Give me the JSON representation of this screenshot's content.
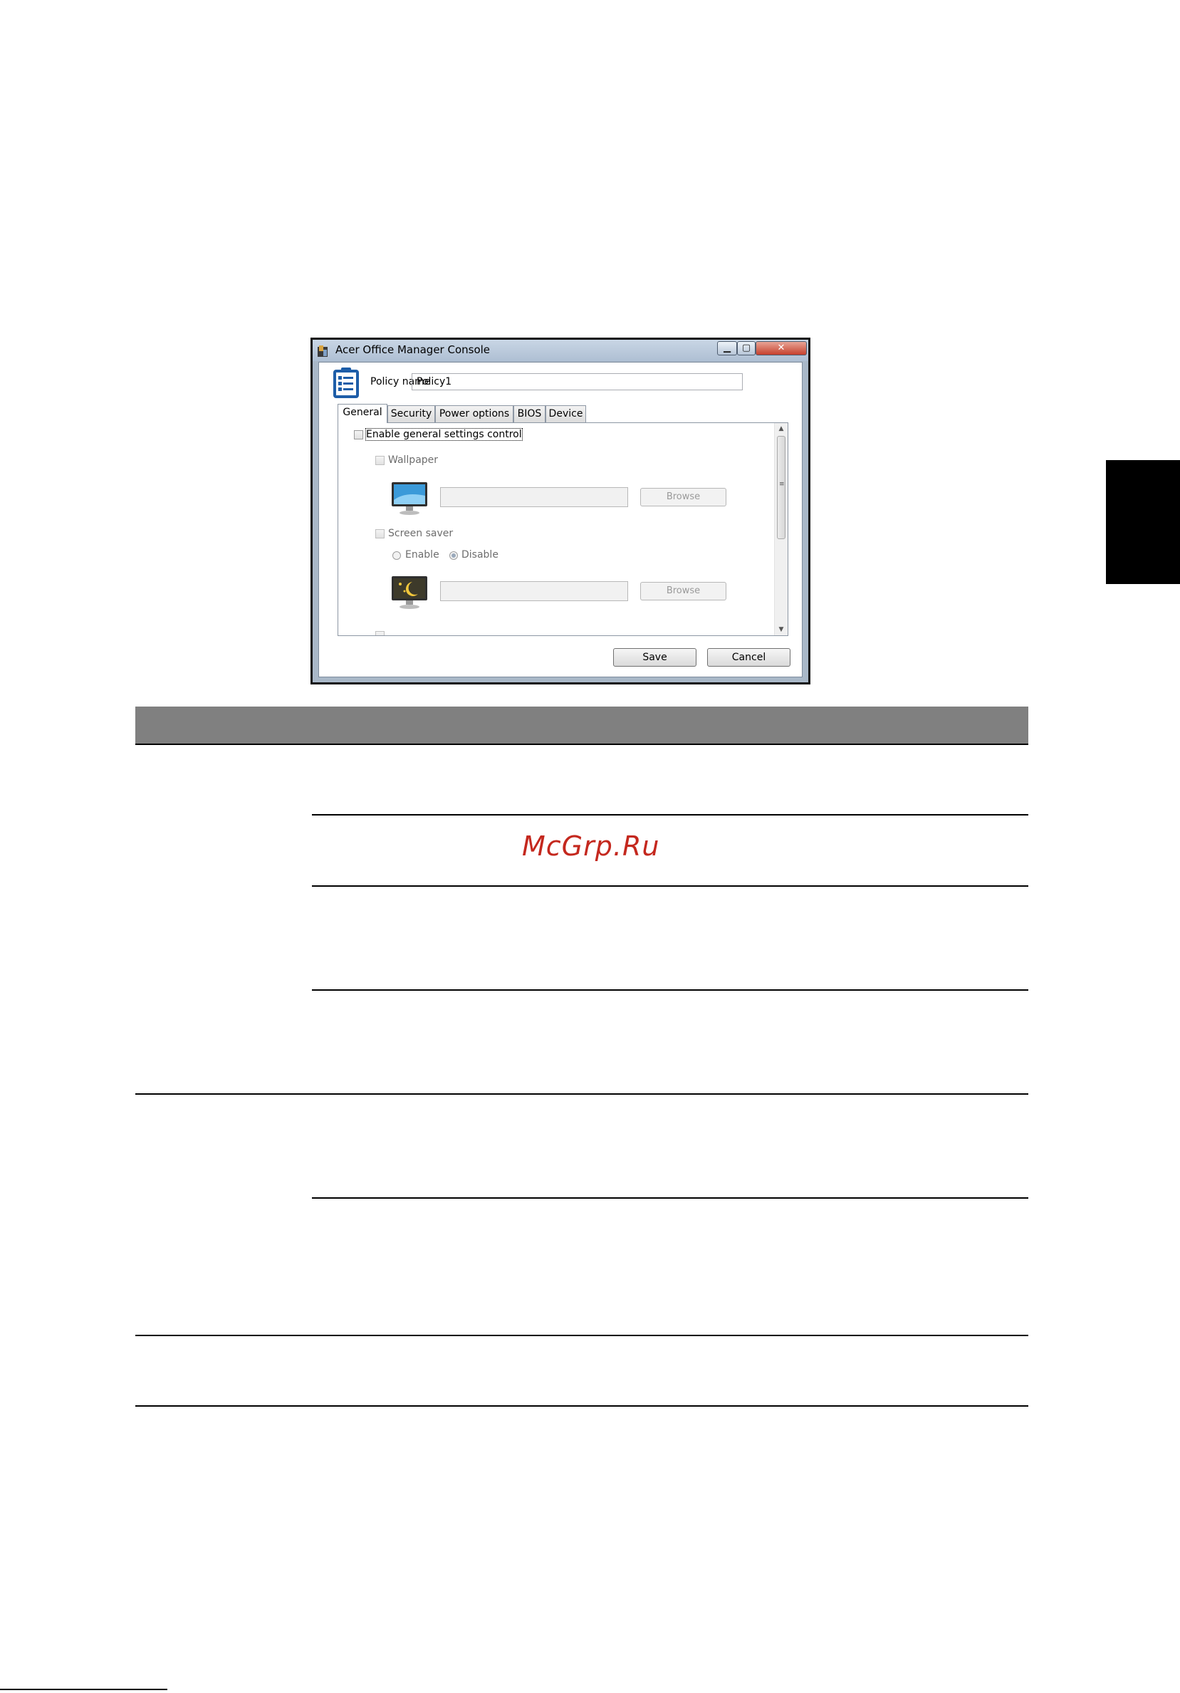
{
  "window": {
    "title": "Acer Office Manager Console",
    "min_glyph": "▁",
    "max_glyph": "▢",
    "close_glyph": "✕"
  },
  "policy": {
    "label": "Policy name",
    "value": "Policy1"
  },
  "tabs": [
    {
      "label": "General",
      "active": true
    },
    {
      "label": "Security"
    },
    {
      "label": "Power options"
    },
    {
      "label": "BIOS"
    },
    {
      "label": "Device"
    }
  ],
  "general": {
    "enable_label": "Enable general settings control",
    "wallpaper_label": "Wallpaper",
    "screensaver_label": "Screen saver",
    "radio_enable": "Enable",
    "radio_disable": "Disable",
    "browse_label": "Browse"
  },
  "buttons": {
    "save": "Save",
    "cancel": "Cancel"
  },
  "watermark": "McGrp.Ru",
  "colors": {
    "table_header": "#808080",
    "watermark": "#c4281e"
  }
}
